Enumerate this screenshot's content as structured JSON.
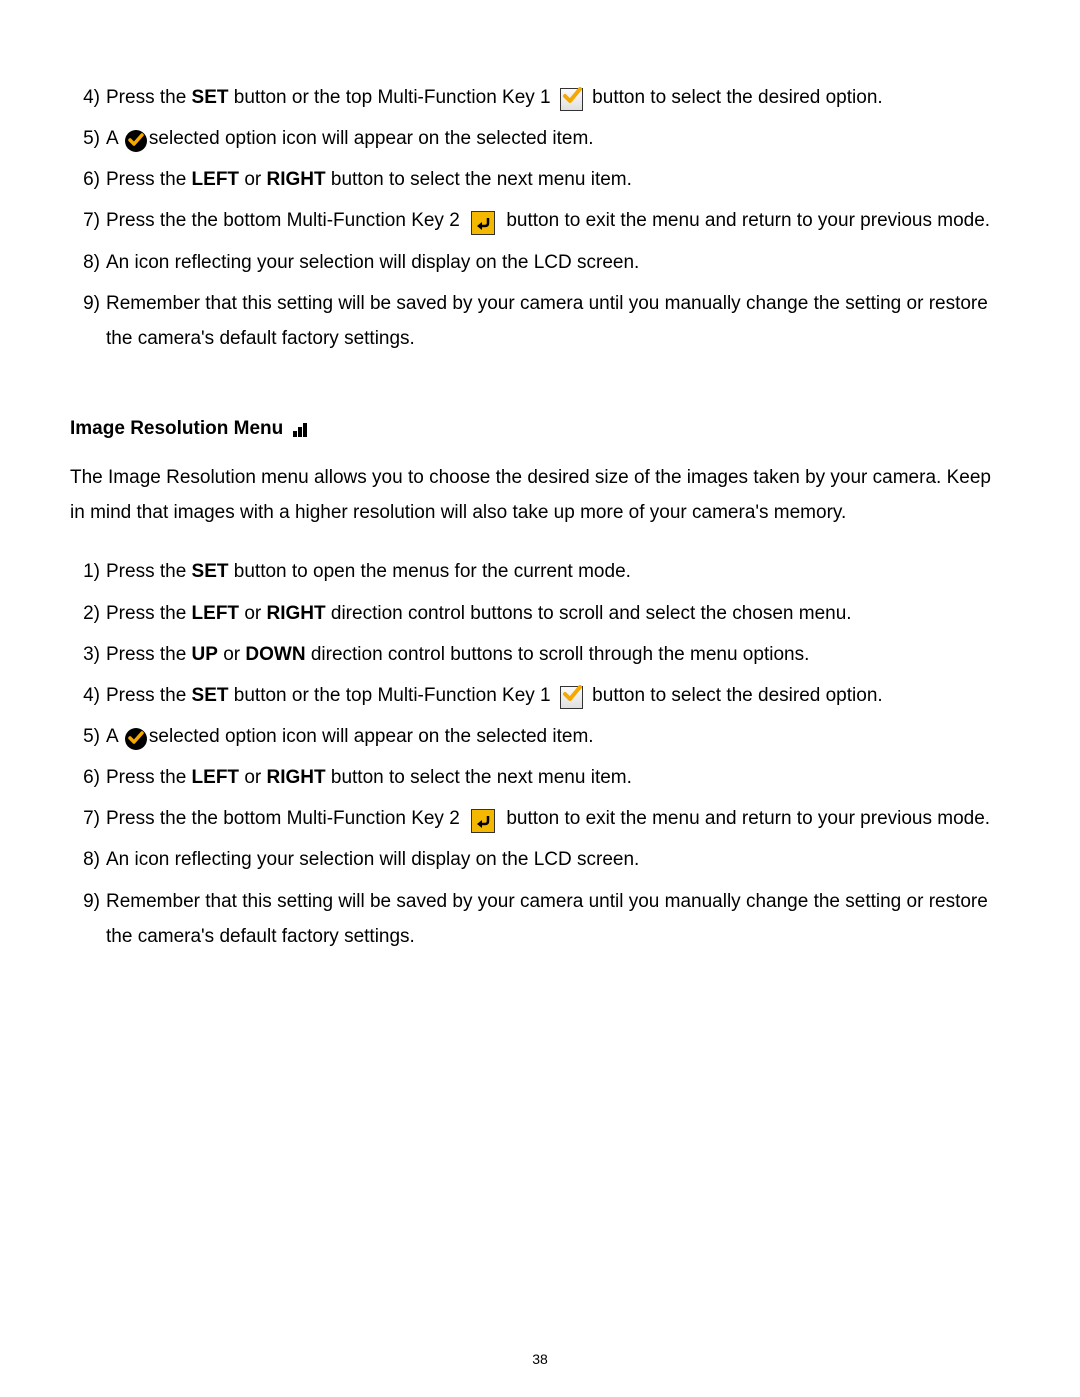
{
  "steps_top": [
    {
      "n": "4)",
      "pre": "Press the ",
      "b1": "SET",
      "mid": " button or the top Multi-Function Key 1 ",
      "icon": "check-box",
      "post": " button to select the desired option."
    },
    {
      "n": "5)",
      "pre": "A ",
      "icon": "check-circle",
      "post": "selected option icon will appear on the selected item."
    },
    {
      "n": "6)",
      "pre": "Press the ",
      "b1": "LEFT",
      "mid": " or ",
      "b2": "RIGHT",
      "post": " button to select the next menu item."
    },
    {
      "n": "7)",
      "pre": "Press the the bottom Multi-Function Key 2 ",
      "icon": "return-box",
      "post": " button to exit the menu and return to your previous mode."
    },
    {
      "n": "8)",
      "text": "An icon reflecting your selection will display on the LCD screen."
    },
    {
      "n": "9)",
      "text": "Remember that this setting will be saved by your camera until you manually change the setting or restore the camera's default factory settings."
    }
  ],
  "section_title": "Image Resolution Menu",
  "section_desc": "The Image Resolution menu allows you to choose the desired size of the images taken by your camera. Keep in mind that images with a higher resolution will also take up more of your camera's memory.",
  "steps_bottom": [
    {
      "n": "1)",
      "pre": "Press the ",
      "b1": "SET",
      "post": " button to open the menus for the current mode."
    },
    {
      "n": "2)",
      "pre": "Press the ",
      "b1": "LEFT",
      "mid": " or ",
      "b2": "RIGHT",
      "post": " direction control buttons to scroll and select the chosen menu."
    },
    {
      "n": "3)",
      "pre": "Press the ",
      "b1": "UP",
      "mid": " or ",
      "b2": "DOWN",
      "post": " direction control buttons to scroll through the menu options."
    },
    {
      "n": "4)",
      "pre": "Press the ",
      "b1": "SET",
      "mid": " button or the top Multi-Function Key 1 ",
      "icon": "check-box",
      "post": " button to select the desired option."
    },
    {
      "n": "5)",
      "pre": "A ",
      "icon": "check-circle",
      "post": "selected option icon will appear on the selected item."
    },
    {
      "n": "6)",
      "pre": "Press the ",
      "b1": "LEFT",
      "mid": " or ",
      "b2": "RIGHT",
      "post": " button to select the next menu item."
    },
    {
      "n": "7)",
      "pre": "Press the the bottom Multi-Function Key 2 ",
      "icon": "return-box",
      "post": " button to exit the menu and return to your previous mode."
    },
    {
      "n": "8)",
      "text": "An icon reflecting your selection will display on the LCD screen."
    },
    {
      "n": "9)",
      "text": "Remember that this setting will be saved by your camera until you manually change the setting or restore the camera's default factory settings."
    }
  ],
  "page_number": "38"
}
